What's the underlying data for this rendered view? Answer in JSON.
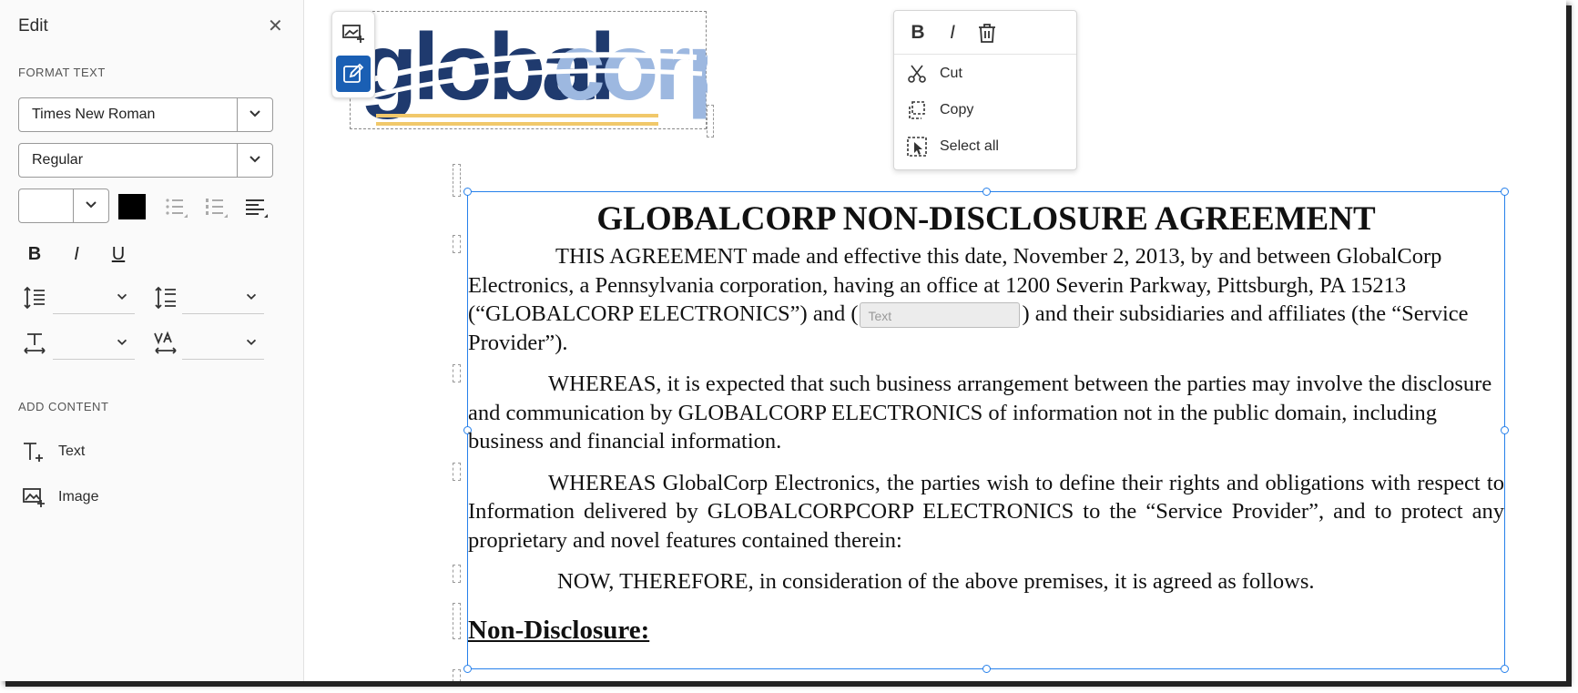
{
  "panel": {
    "title": "Edit",
    "format_text_label": "FORMAT TEXT",
    "font_family": "Times New Roman",
    "font_style": "Regular",
    "bold": "B",
    "italic": "I",
    "underline": "U",
    "add_content_label": "ADD CONTENT",
    "add_text": "Text",
    "add_image": "Image",
    "color": "#000000"
  },
  "context_menu": {
    "bold": "B",
    "italic": "I",
    "cut": "Cut",
    "copy": "Copy",
    "select_all": "Select all"
  },
  "logo": {
    "part1": "global",
    "part2": "corp",
    "color1": "#1f3a6e",
    "color2": "#9db8e0"
  },
  "document": {
    "title": "GLOBALCORP NON-DISCLOSURE AGREEMENT",
    "p1_a": "THIS AGREEMENT made and effective this date, November 2, 2013, by and between GlobalCorp Electronics, a Pennsylvania corporation, having an office at 1200 Severin Parkway, Pittsburgh, PA 15213 (“GLOBALCORP ELECTRONICS”) and (",
    "p1_field_placeholder": "Text",
    "p1_b": ") and their subsidiaries and affiliates (the “Service Provider”).",
    "p2": "WHEREAS, it is expected that such business arrangement between the parties may involve the disclosure and communication by GLOBALCORP ELECTRONICS of information not in the public domain, including business and financial information.",
    "p3": "WHEREAS GlobalCorp Electronics, the parties wish to define their rights and obligations with respect to Information delivered by GLOBALCORPCORP ELECTRONICS to the “Service Provider”, and to protect any proprietary and novel features contained therein:",
    "p4": "NOW, THEREFORE, in consideration of the above premises, it is agreed as follows.",
    "heading": "Non-Disclosure:"
  },
  "colors": {
    "accent": "#2680eb",
    "edit_button": "#1a5fb4"
  }
}
